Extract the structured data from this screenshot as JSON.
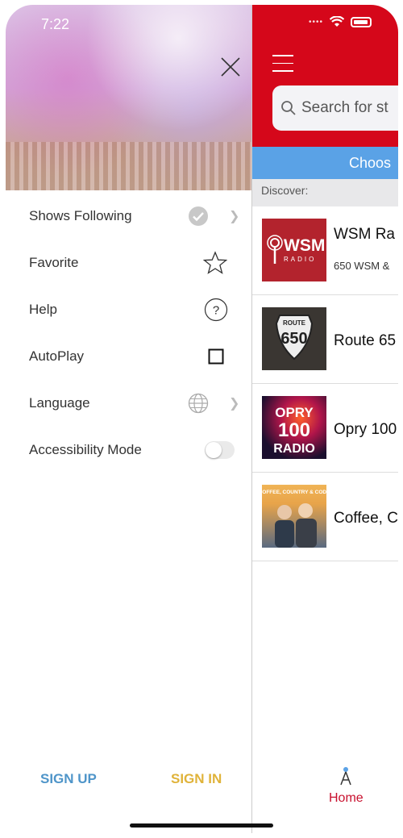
{
  "status_bar": {
    "time": "7:22"
  },
  "main": {
    "search_placeholder": "Search for st",
    "choose_label": "Choos",
    "discover_label": "Discover:",
    "stations": [
      {
        "name": "WSM Ra",
        "subtitle": "650 WSM &",
        "logo_text": "WSM",
        "logo_sub": "RADIO"
      },
      {
        "name": "Route 65",
        "logo_text": "650",
        "logo_sub": "ROUTE"
      },
      {
        "name": "Opry 100",
        "logo_text": "OPRY 100 RADIO"
      },
      {
        "name": "Coffee, C",
        "logo_text": "COFFEE, COUNTRY & CODY"
      }
    ],
    "tab_home": "Home"
  },
  "drawer": {
    "menu": [
      {
        "label": "Shows Following",
        "icon": "checkmark-circle-icon"
      },
      {
        "label": "Favorite",
        "icon": "star-outline-icon"
      },
      {
        "label": "Help",
        "icon": "question-circle-icon"
      },
      {
        "label": "AutoPlay",
        "icon": "checkbox-icon"
      },
      {
        "label": "Language",
        "icon": "globe-icon"
      },
      {
        "label": "Accessibility Mode",
        "icon": "toggle-switch"
      }
    ],
    "signup_label": "SIGN UP",
    "signin_label": "SIGN IN"
  },
  "colors": {
    "header_red": "#d5071a",
    "choose_blue": "#5aa2e6",
    "signup_blue": "#4f95c9",
    "signin_gold": "#e0b33a"
  }
}
